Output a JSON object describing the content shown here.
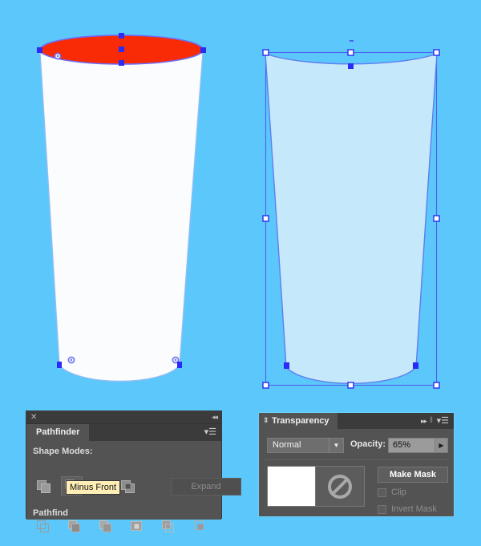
{
  "app": {
    "background_color": "#5bc7fb"
  },
  "artwork": {
    "left_shape": {
      "name": "cup-body-left",
      "fill_color": "#fafcfd",
      "stroke_color": "#8ab6f0",
      "top_ellipse": {
        "name": "cup-top-ellipse",
        "fill_color": "#f92b06",
        "stroke_color": "#6d6bf5"
      },
      "anchor_color": "#2b2bf5"
    },
    "right_shape": {
      "name": "cup-body-right",
      "fill_color": "#c5e8fb",
      "stroke_color": "#5f7ef0",
      "bbox_handle_fill": "#ffffff",
      "bbox_handle_stroke": "#2b2bf5",
      "bbox_line_color": "#4d63ef"
    }
  },
  "pathfinder": {
    "title": "Pathfinder",
    "close_icon": "✕",
    "collapse_icon": "◂◂",
    "menu_icon": "▾☰",
    "shape_modes_label": "Shape Modes:",
    "pathfinders_label": "Pathfind",
    "expand_label": "Expand",
    "shape_mode_buttons": [
      {
        "name": "unite",
        "active": false
      },
      {
        "name": "minus-front",
        "active": true
      },
      {
        "name": "intersect",
        "active": false
      },
      {
        "name": "exclude",
        "active": false
      }
    ],
    "pathfinder_buttons": [
      {
        "name": "divide"
      },
      {
        "name": "trim"
      },
      {
        "name": "merge"
      },
      {
        "name": "crop"
      },
      {
        "name": "outline"
      },
      {
        "name": "minus-back"
      }
    ],
    "tooltip": "Minus Front"
  },
  "transparency": {
    "title": "Transparency",
    "tab_arrows_icon": "⇕",
    "expand_icon": "▸▸",
    "divider_icon": "‖",
    "menu_icon": "▾☰",
    "blend_mode": "Normal",
    "blend_mode_arrow": "▼",
    "opacity_label": "Opacity:",
    "opacity_value": "65%",
    "opacity_arrow": "▶",
    "make_mask_label": "Make Mask",
    "clip_label": "Clip",
    "clip_checked": false,
    "invert_mask_label": "Invert Mask",
    "invert_mask_checked": false,
    "mask_thumb_state": "no-mask"
  }
}
